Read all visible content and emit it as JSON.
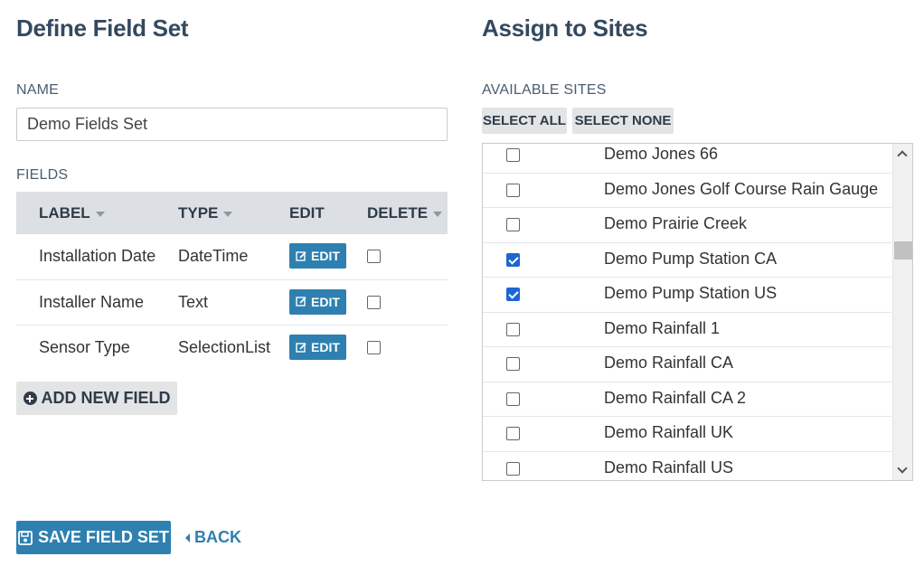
{
  "left": {
    "title": "Define Field Set",
    "name_label": "NAME",
    "name_value": "Demo Fields Set",
    "fields_label": "FIELDS",
    "columns": {
      "label": "LABEL",
      "type": "TYPE",
      "edit": "EDIT",
      "delete": "DELETE"
    },
    "rows": [
      {
        "label": "Installation Date",
        "type": "DateTime",
        "edit": "EDIT",
        "delete": false
      },
      {
        "label": "Installer Name",
        "type": "Text",
        "edit": "EDIT",
        "delete": false
      },
      {
        "label": "Sensor Type",
        "type": "SelectionList",
        "edit": "EDIT",
        "delete": false
      }
    ],
    "add_field": "ADD NEW FIELD",
    "save": "SAVE FIELD SET",
    "back": "BACK"
  },
  "right": {
    "title": "Assign to Sites",
    "available_label": "AVAILABLE SITES",
    "select_all": "SELECT ALL",
    "select_none": "SELECT NONE",
    "sites": [
      {
        "name": "Demo Jones 66",
        "checked": false
      },
      {
        "name": "Demo Jones Golf Course Rain Gauge",
        "checked": false
      },
      {
        "name": "Demo Prairie Creek",
        "checked": false
      },
      {
        "name": "Demo Pump Station CA",
        "checked": true
      },
      {
        "name": "Demo Pump Station US",
        "checked": true
      },
      {
        "name": "Demo Rainfall 1",
        "checked": false
      },
      {
        "name": "Demo Rainfall CA",
        "checked": false
      },
      {
        "name": "Demo Rainfall CA 2",
        "checked": false
      },
      {
        "name": "Demo Rainfall UK",
        "checked": false
      },
      {
        "name": "Demo Rainfall US",
        "checked": false
      }
    ]
  },
  "colors": {
    "primary": "#2e80b0",
    "heading": "#34495e",
    "checkbox_checked": "#1a66d2"
  },
  "icons": {
    "edit": "edit-icon",
    "add": "plus-circle-icon",
    "save": "floppy-disk-icon",
    "back": "caret-left-icon"
  }
}
